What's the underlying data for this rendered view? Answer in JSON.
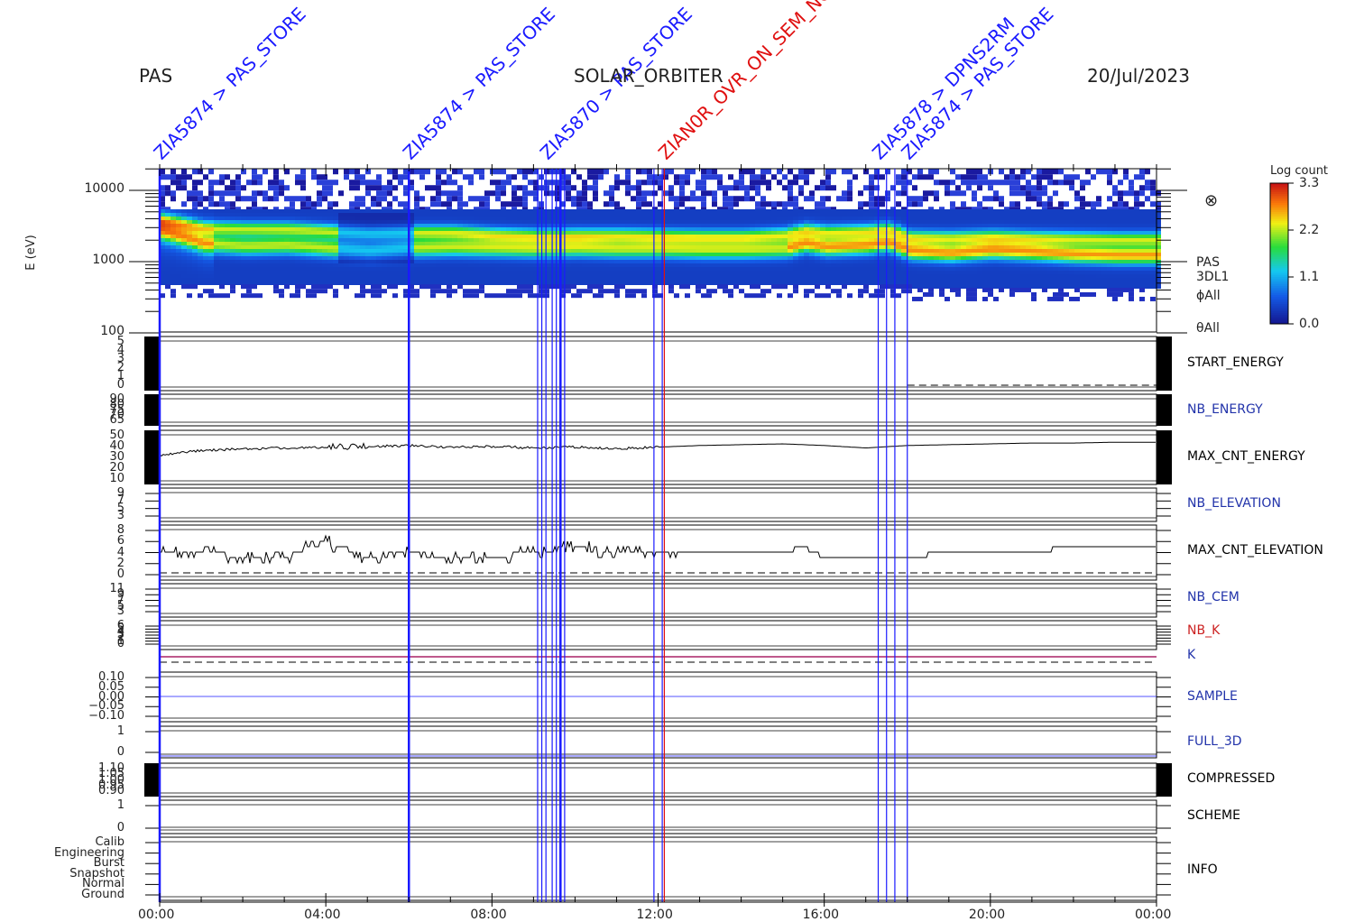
{
  "header": {
    "left": "PAS",
    "center": "SOLAR_ORBITER",
    "right": "20/Jul/2023"
  },
  "spectrogram": {
    "ylabel": "E (eV)",
    "yticks": [
      "10000",
      "1000",
      "100"
    ],
    "right_labels": [
      "PAS",
      "3DL1",
      "ϕAll",
      "θAll"
    ],
    "right_symbol": "⊗",
    "colorbar": {
      "title": "Log count",
      "ticks": [
        "3.3",
        "2.2",
        "1.1",
        "0.0"
      ]
    }
  },
  "xaxis": {
    "ticks": [
      "00:00",
      "04:00",
      "08:00",
      "12:00",
      "16:00",
      "20:00",
      "00:00"
    ]
  },
  "panels": [
    {
      "name": "START_ENERGY",
      "color": "#000000",
      "yticks": [
        "5",
        "4",
        "3",
        "2",
        "1",
        "0"
      ]
    },
    {
      "name": "NB_ENERGY",
      "color": "#2233aa",
      "yticks": [
        "90",
        "80",
        "75",
        "70",
        "65"
      ]
    },
    {
      "name": "MAX_CNT_ENERGY",
      "color": "#000000",
      "yticks": [
        "50",
        "40",
        "30",
        "20",
        "10"
      ]
    },
    {
      "name": "NB_ELEVATION",
      "color": "#2233aa",
      "yticks": [
        "9",
        "7",
        "5",
        "3"
      ]
    },
    {
      "name": "MAX_CNT_ELEVATION",
      "color": "#000000",
      "yticks": [
        "8",
        "6",
        "4",
        "2",
        "0"
      ]
    },
    {
      "name": "NB_CEM",
      "color": "#2233aa",
      "yticks": [
        "11",
        "9",
        "7",
        "5",
        "3"
      ]
    },
    {
      "name": "NB_K",
      "color": "#cc2222",
      "yticks": [
        "6",
        "5",
        "4",
        "3",
        "2",
        "1",
        "0"
      ]
    },
    {
      "name": "K",
      "color": "#2233aa",
      "yticks": []
    },
    {
      "name": "SAMPLE",
      "color": "#2233aa",
      "yticks": [
        "0.10",
        "0.05",
        "0.00",
        "−0.05",
        "−0.10"
      ]
    },
    {
      "name": "FULL_3D",
      "color": "#2233aa",
      "yticks": [
        "1",
        "0"
      ]
    },
    {
      "name": "COMPRESSED",
      "color": "#000000",
      "yticks": [
        "1.10",
        "1.05",
        "1.00",
        "0.95",
        "0.90"
      ]
    },
    {
      "name": "SCHEME",
      "color": "#000000",
      "yticks": [
        "1",
        "0"
      ]
    },
    {
      "name": "INFO",
      "color": "#000000",
      "yticks": [
        "Calib",
        "Engineering",
        "Burst",
        "Snapshot",
        "Normal",
        "Ground"
      ]
    }
  ],
  "event_labels": [
    "ZIA5874 > PAS_STORE",
    "ZIA5874 > PAS_STORE",
    "ZIA5870 > PAS_STORE",
    "ZIAN0R_OVR_ON_SEM_NOT",
    "ZIA5878 > DPNS2RM",
    "ZIA5874 > PAS_STORE"
  ],
  "colors": {
    "event_line": "#1a1aff",
    "event_red": "#e01010",
    "k_line": "#aa2266",
    "axis": "#000000"
  },
  "chart_data": {
    "type": "heatmap",
    "x_range": [
      "00:00",
      "24:00"
    ],
    "x_unit": "hours UT",
    "y_scale": "log",
    "y_range_eV": [
      100,
      20000
    ],
    "color_range": [
      0.0,
      3.3
    ],
    "energy_bands": [
      {
        "x_hours": [
          0,
          1,
          2,
          3,
          4,
          5,
          6,
          7,
          8,
          9,
          10,
          11,
          12,
          13,
          14,
          15,
          15.5,
          16,
          17,
          17.5,
          18,
          19,
          20,
          21,
          22,
          23,
          24
        ],
        "peak_eV": [
          2800,
          1900,
          1750,
          1800,
          1650,
          1500,
          1650,
          1700,
          1650,
          1600,
          1650,
          1600,
          1600,
          1550,
          1550,
          1600,
          1900,
          1700,
          1800,
          1950,
          1500,
          1400,
          1550,
          1450,
          1350,
          1300,
          1300
        ]
      },
      {
        "x_hours": [
          0,
          1,
          2,
          3,
          4,
          5,
          6,
          7,
          8,
          9,
          10,
          11,
          12,
          13,
          14,
          15,
          15.5,
          16,
          17,
          17.5,
          18,
          19,
          20,
          21,
          22,
          23,
          24
        ],
        "peak_eV": [
          4000,
          3100,
          3000,
          3000,
          2800,
          2600,
          2700,
          2700,
          2500,
          2400,
          2450,
          2450,
          2400,
          2350,
          2350,
          2500,
          2900,
          2700,
          2800,
          3000,
          2300,
          2250,
          2350,
          2250,
          2200,
          2150,
          2150
        ]
      }
    ],
    "max_cnt_energy": {
      "x_hours": [
        0,
        1,
        2,
        3,
        4,
        5,
        6,
        7,
        8,
        9,
        10,
        11,
        12,
        13,
        14,
        15,
        16,
        17,
        18,
        19,
        20,
        21,
        22,
        23,
        24
      ],
      "y": [
        30,
        36,
        38,
        39,
        40,
        41,
        42,
        40,
        41,
        39,
        40,
        38,
        40,
        42,
        43,
        44,
        42,
        39,
        42,
        43,
        44,
        45,
        45,
        46,
        46
      ],
      "ylim": [
        0,
        55
      ]
    },
    "max_cnt_elevation": {
      "x_hours": [
        0,
        1,
        2,
        3,
        4,
        5,
        6,
        7,
        8,
        9,
        10,
        11,
        12,
        13,
        14,
        15,
        15.5,
        16,
        17,
        18,
        19,
        20,
        21,
        22,
        23,
        24
      ],
      "y": [
        4,
        4,
        3,
        3,
        6,
        3,
        4,
        3,
        3,
        4,
        5,
        4,
        4,
        4,
        4,
        4,
        5,
        3,
        3,
        3,
        4,
        4,
        4,
        5,
        5,
        5
      ],
      "ylim": [
        0,
        8
      ]
    },
    "start_energy": {
      "value_after": 0,
      "switch_hour": 18.0
    },
    "event_hours": [
      0.0,
      6.0,
      9.1,
      9.2,
      9.3,
      9.45,
      9.55,
      9.65,
      9.75,
      11.9,
      12.1,
      17.3,
      17.5,
      17.7,
      18.0
    ],
    "event_red_hour": 12.15
  }
}
